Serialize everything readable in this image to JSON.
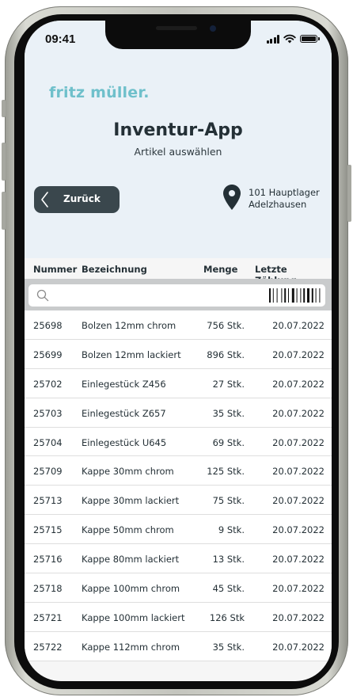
{
  "status_bar": {
    "time": "09:41",
    "icons": [
      "cellular-signal-icon",
      "wifi-icon",
      "battery-icon"
    ]
  },
  "header": {
    "brand": "fritz müller.",
    "title": "Inventur-App",
    "subtitle": "Artikel auswählen",
    "back_label": "Zurück",
    "location_line1": "101 Hauptlager",
    "location_line2": "Adelzhausen"
  },
  "table": {
    "columns": [
      "Nummer",
      "Bezeichnung",
      "Menge",
      "Letzte Zählung"
    ],
    "search_placeholder": "",
    "rows": [
      {
        "number": "25698",
        "name": "Bolzen 12mm chrom",
        "qty": "756 Stk.",
        "date": "20.07.2022"
      },
      {
        "number": "25699",
        "name": "Bolzen 12mm lackiert",
        "qty": "896 Stk.",
        "date": "20.07.2022"
      },
      {
        "number": "25702",
        "name": "Einlegestück Z456",
        "qty": "27 Stk.",
        "date": "20.07.2022"
      },
      {
        "number": "25703",
        "name": "Einlegestück Z657",
        "qty": "35 Stk.",
        "date": "20.07.2022"
      },
      {
        "number": "25704",
        "name": "Einlegestück U645",
        "qty": "69 Stk.",
        "date": "20.07.2022"
      },
      {
        "number": "25709",
        "name": "Kappe 30mm chrom",
        "qty": "125 Stk.",
        "date": "20.07.2022"
      },
      {
        "number": "25713",
        "name": "Kappe 30mm lackiert",
        "qty": "75 Stk.",
        "date": "20.07.2022"
      },
      {
        "number": "25715",
        "name": "Kappe 50mm chrom",
        "qty": "9 Stk.",
        "date": "20.07.2022"
      },
      {
        "number": "25716",
        "name": "Kappe 80mm lackiert",
        "qty": "13 Stk.",
        "date": "20.07.2022"
      },
      {
        "number": "25718",
        "name": "Kappe 100mm chrom",
        "qty": "45 Stk.",
        "date": "20.07.2022"
      },
      {
        "number": "25721",
        "name": "Kappe 100mm lackiert",
        "qty": "126 Stk",
        "date": "20.07.2022"
      },
      {
        "number": "25722",
        "name": "Kappe 112mm chrom",
        "qty": "35 Stk.",
        "date": "20.07.2022"
      }
    ]
  },
  "colors": {
    "brand": "#6fc0cb",
    "header_bg": "#eaf1f7",
    "button": "#3a474d",
    "text": "#243036"
  }
}
